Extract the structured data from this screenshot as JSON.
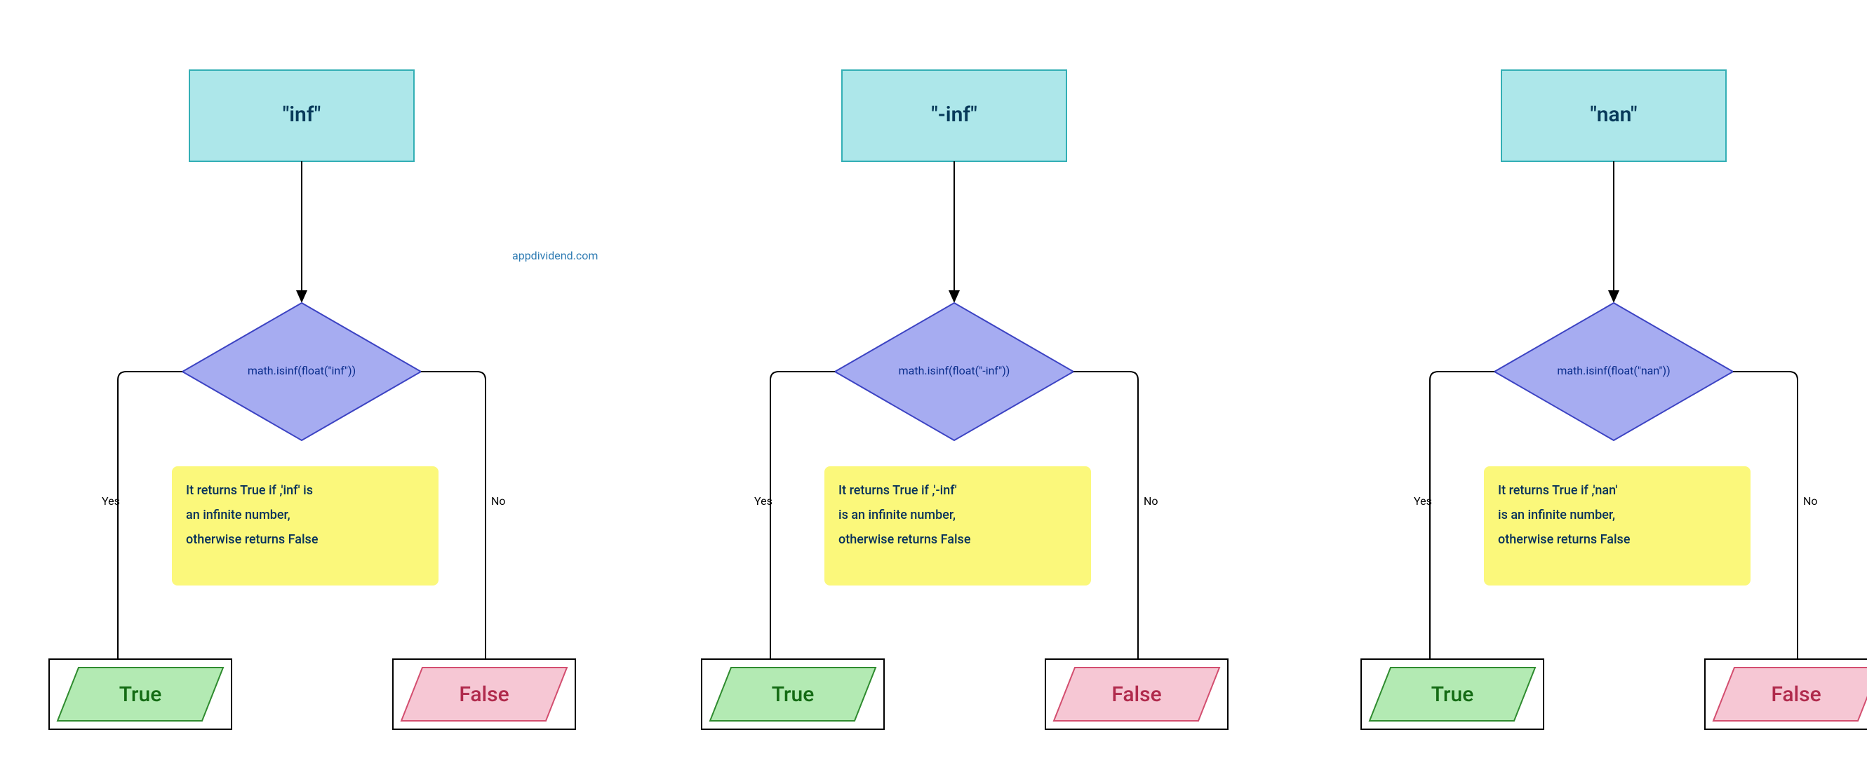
{
  "attribution": "appdividend.com",
  "charts": [
    {
      "start_label": "\"inf\"",
      "decision_label": "math.isinf(float(\"inf\"))",
      "yes_label": "Yes",
      "no_label": "No",
      "note_line1": "It returns True if ,'inf' is",
      "note_line2": "an infinite number,",
      "note_line3": "otherwise returns False",
      "true_label": "True",
      "false_label": "False"
    },
    {
      "start_label": "\"-inf\"",
      "decision_label": "math.isinf(float(\"-inf\"))",
      "yes_label": "Yes",
      "no_label": "No",
      "note_line1": "It returns True if ,'-inf'",
      "note_line2": "is an infinite number,",
      "note_line3": "otherwise returns False",
      "true_label": "True",
      "false_label": "False"
    },
    {
      "start_label": "\"nan\"",
      "decision_label": "math.isinf(float(\"nan\"))",
      "yes_label": "Yes",
      "no_label": "No",
      "note_line1": "It returns True if  ,'nan'",
      "note_line2": "is an infinite number,",
      "note_line3": "otherwise returns False",
      "true_label": "True",
      "false_label": "False"
    }
  ]
}
